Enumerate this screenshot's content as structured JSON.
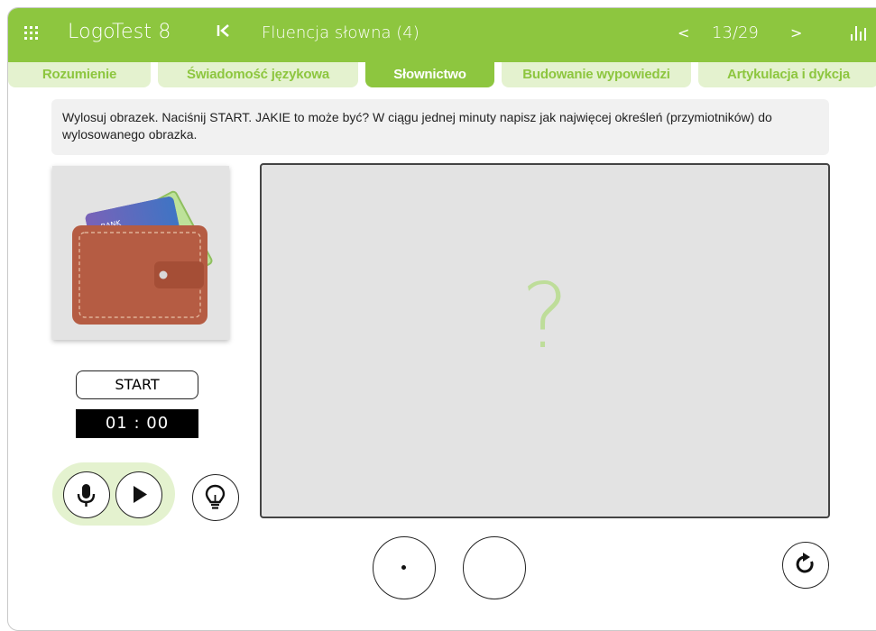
{
  "header": {
    "app_title": "LogoTest 8",
    "exercise_title": "Fluencja słowna (4)",
    "prev_label": "<",
    "counter": "13/29",
    "next_label": ">"
  },
  "tabs": [
    {
      "label": "Rozumienie",
      "active": false
    },
    {
      "label": "Świadomość językowa",
      "active": false
    },
    {
      "label": "Słownictwo",
      "active": true
    },
    {
      "label": "Budowanie wypowiedzi",
      "active": false
    },
    {
      "label": "Artykulacja i dykcja",
      "active": false
    }
  ],
  "instruction": "Wylosuj obrazek. Naciśnij START. JAKIE to może być? W ciągu jednej minuty napisz jak najwięcej określeń (przymiotników) do wylosowanego obrazka.",
  "picture": {
    "icon": "wallet-icon",
    "card_text": "BANK"
  },
  "start_label": "START",
  "timer": "01 : 00",
  "canvas": {
    "placeholder": "?"
  },
  "colors": {
    "brand_green": "#8dc63f",
    "tab_inactive": "#e4f2cf",
    "placeholder": "#bedd9a"
  }
}
